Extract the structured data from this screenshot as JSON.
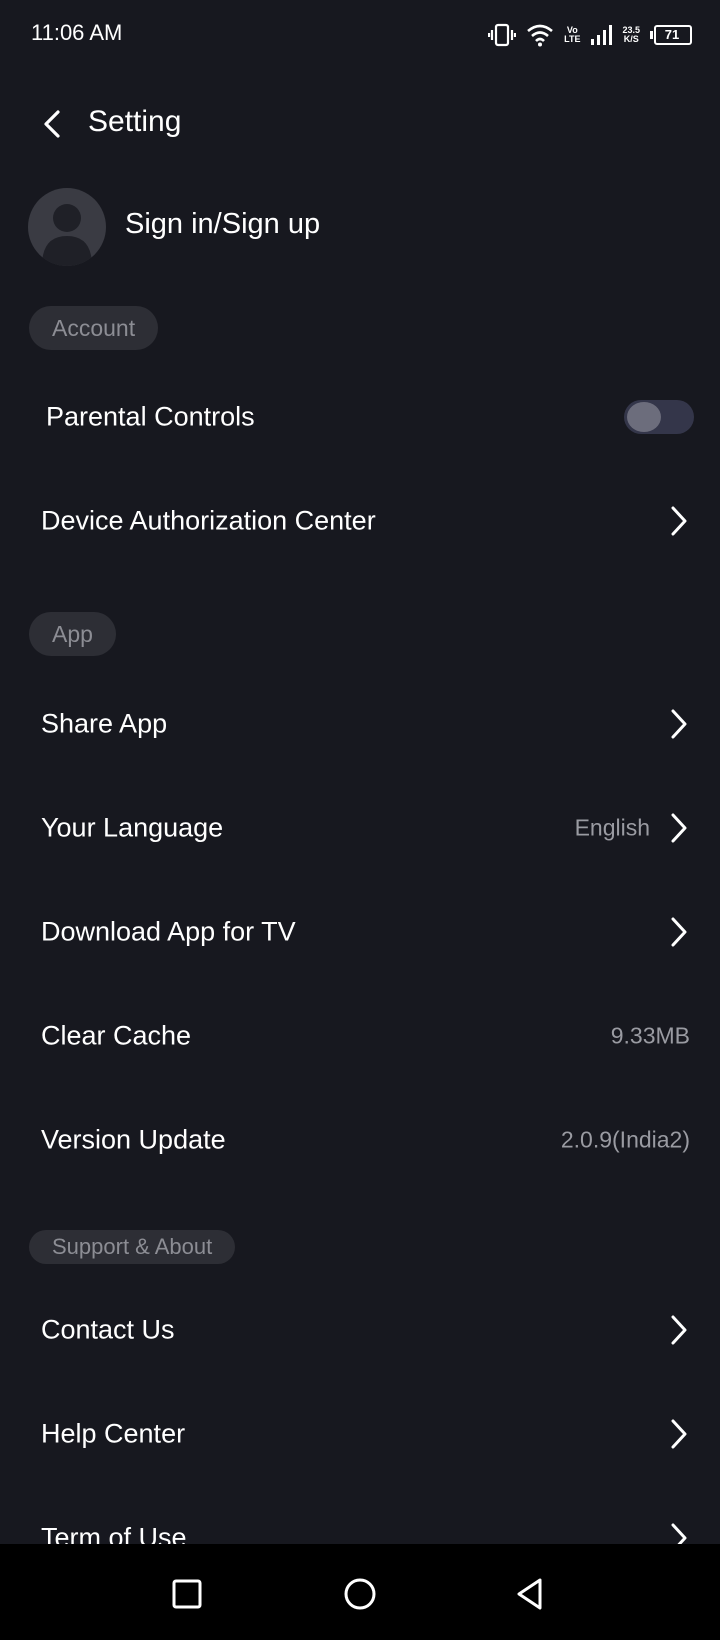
{
  "status_bar": {
    "time": "11:06 AM",
    "network_top": "Vo",
    "network_bottom": "LTE",
    "speed_top": "23.5",
    "speed_bottom": "K/S",
    "battery": "71",
    "icons": [
      "vibrate-icon",
      "wifi-icon",
      "signal-icon",
      "battery-icon"
    ]
  },
  "header": {
    "title": "Setting"
  },
  "profile": {
    "signin_label": "Sign in/Sign up"
  },
  "sections": {
    "account": {
      "label": "Account",
      "parental_controls": {
        "label": "Parental Controls",
        "enabled": false
      },
      "device_auth": {
        "label": "Device Authorization Center"
      }
    },
    "app": {
      "label": "App",
      "share_app": {
        "label": "Share App"
      },
      "language": {
        "label": "Your Language",
        "value": "English"
      },
      "download_tv": {
        "label": "Download App for TV"
      },
      "clear_cache": {
        "label": "Clear Cache",
        "value": "9.33MB"
      },
      "version_update": {
        "label": "Version Update",
        "value": "2.0.9(India2)"
      }
    },
    "support": {
      "label": "Support & About",
      "contact_us": {
        "label": "Contact Us"
      },
      "help_center": {
        "label": "Help Center"
      },
      "term_of_use": {
        "label": "Term of Use"
      }
    }
  },
  "colors": {
    "background": "#17181f",
    "pill_bg": "#2d2e35",
    "pill_text": "#8c8d94",
    "secondary_text": "#9a9ba2",
    "toggle_track": "#34364a",
    "toggle_knob": "#6c6d7c"
  },
  "nav_bar": {
    "icons": [
      "recent-apps-icon",
      "home-icon",
      "back-nav-icon"
    ]
  }
}
